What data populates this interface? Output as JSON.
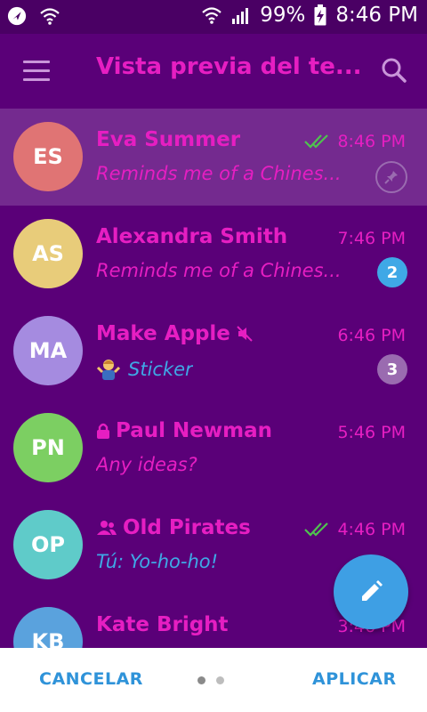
{
  "status": {
    "battery": "99%",
    "time": "8:46 PM"
  },
  "header": {
    "title": "Vista previa del te..."
  },
  "chats": [
    {
      "initials": "ES",
      "name": "Eva Summer",
      "time": "8:46 PM",
      "message": "Reminds me of a Chines...",
      "avatar_color": "#e07474"
    },
    {
      "initials": "AS",
      "name": "Alexandra Smith",
      "time": "7:46 PM",
      "message": "Reminds me of a Chines...",
      "badge": "2",
      "avatar_color": "#e8cc7a"
    },
    {
      "initials": "MA",
      "name": "Make Apple",
      "time": "6:46 PM",
      "message": "Sticker",
      "badge": "3",
      "avatar_color": "#a58be0"
    },
    {
      "initials": "PN",
      "name": "Paul Newman",
      "time": "5:46 PM",
      "message": "Any ideas?",
      "avatar_color": "#7ccf62"
    },
    {
      "initials": "OP",
      "name": "Old Pirates",
      "time": "4:46 PM",
      "message": "Tú: Yo-ho-ho!",
      "avatar_color": "#5fcbc9"
    },
    {
      "initials": "KB",
      "name": "Kate Bright",
      "time": "3:46 PM",
      "avatar_color": "#5aa2dd"
    }
  ],
  "footer": {
    "cancel": "CANCELAR",
    "apply": "APLICAR"
  },
  "colors": {
    "background": "#5a0078",
    "accent": "#e61ec2",
    "link": "#3fa8e6",
    "checks": "#4fc24f"
  },
  "icons": [
    "navigation-icon",
    "wifi-icon",
    "signal-icon",
    "battery-charging-icon",
    "menu-icon",
    "search-icon",
    "double-check-icon",
    "pin-icon",
    "mute-icon",
    "lock-icon",
    "group-icon",
    "edit-pencil-icon"
  ]
}
